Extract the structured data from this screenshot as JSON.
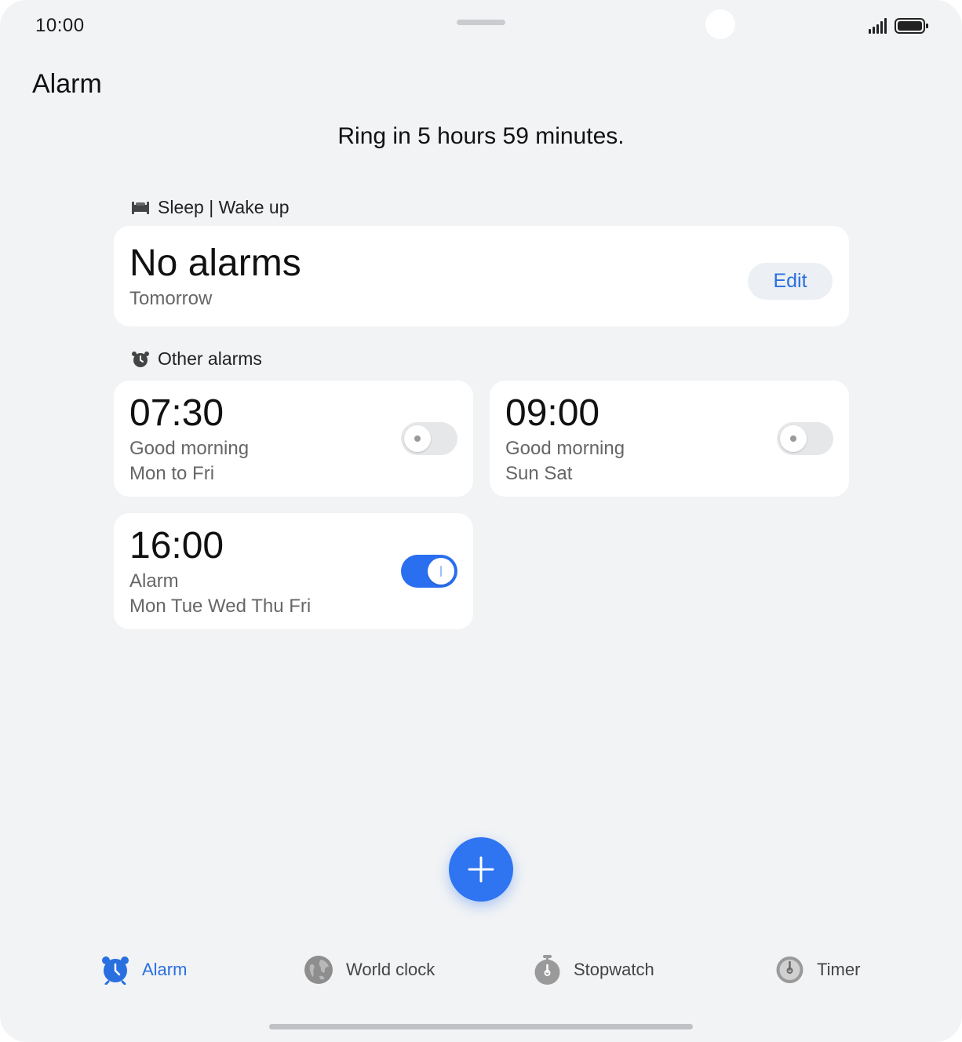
{
  "status_bar": {
    "time": "10:00"
  },
  "header": {
    "title": "Alarm"
  },
  "next_ring": "Ring in 5 hours 59 minutes.",
  "sleep_section": {
    "label": "Sleep | Wake up",
    "icon": "bed-icon",
    "card": {
      "title": "No alarms",
      "subtitle": "Tomorrow",
      "edit_label": "Edit"
    }
  },
  "other_section": {
    "label": "Other alarms",
    "icon": "alarm-clock-icon",
    "alarms": [
      {
        "time": "07:30",
        "name": "Good morning",
        "repeat": "Mon to Fri",
        "enabled": false
      },
      {
        "time": "09:00",
        "name": "Good morning",
        "repeat": "Sun Sat",
        "enabled": false
      },
      {
        "time": "16:00",
        "name": "Alarm",
        "repeat": "Mon Tue Wed Thu Fri",
        "enabled": true
      }
    ]
  },
  "fab": {
    "icon": "plus-icon"
  },
  "tabs": [
    {
      "label": "Alarm",
      "icon": "alarm-icon",
      "active": true
    },
    {
      "label": "World clock",
      "icon": "globe-icon",
      "active": false
    },
    {
      "label": "Stopwatch",
      "icon": "stopwatch-icon",
      "active": false
    },
    {
      "label": "Timer",
      "icon": "timer-icon",
      "active": false
    }
  ],
  "colors": {
    "accent": "#2a6ff0",
    "background": "#f1f3f5",
    "card": "#ffffff"
  }
}
